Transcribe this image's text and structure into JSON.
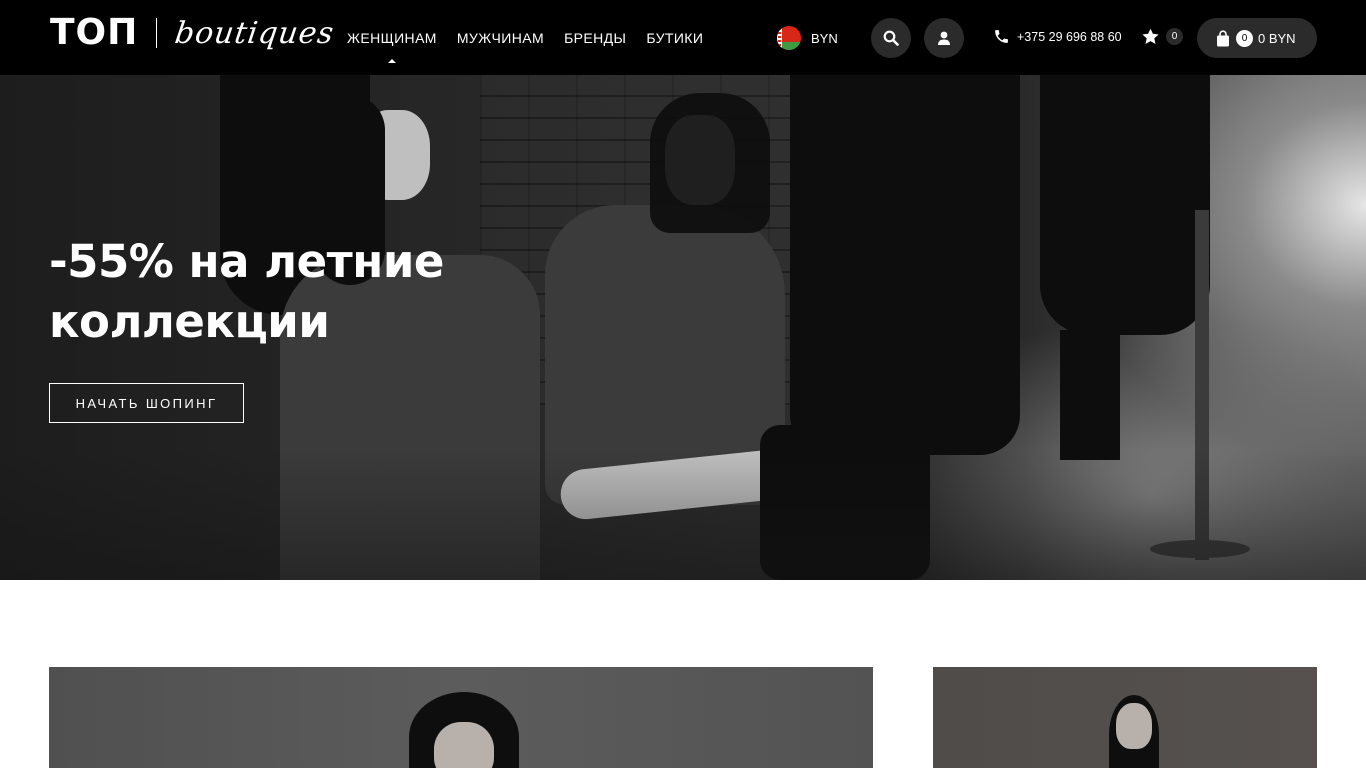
{
  "header": {
    "logo": {
      "main": "ТОП",
      "script": "boutiques"
    },
    "nav": [
      {
        "label": "ЖЕНЩИНАМ",
        "active": true
      },
      {
        "label": "МУЖЧИНАМ",
        "active": false
      },
      {
        "label": "БРЕНДЫ",
        "active": false
      },
      {
        "label": "БУТИКИ",
        "active": false
      }
    ],
    "currency": {
      "flag": "belarus-flag-icon",
      "label": "BYN"
    },
    "search_icon": "search-icon",
    "account_icon": "user-icon",
    "phone": {
      "icon": "phone-icon",
      "number": "+375 29 696 88 60"
    },
    "favorites": {
      "icon": "star-icon",
      "count": "0"
    },
    "cart": {
      "icon": "shopping-bag-icon",
      "count": "0",
      "total": "0 BYN"
    }
  },
  "hero": {
    "title": "-55% на летние коллекции",
    "cta": "НАЧАТЬ ШОПИНГ"
  },
  "colors": {
    "header_bg": "#000000",
    "button_dark": "#2b2b2b",
    "text_light": "#ffffff"
  }
}
